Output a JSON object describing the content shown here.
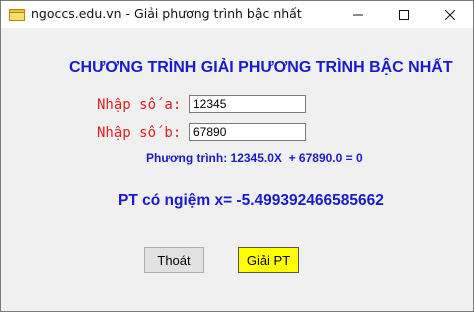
{
  "window": {
    "title": "ngoccs.edu.vn - Giải phương trình bậc nhất"
  },
  "heading": "CHƯƠNG TRÌNH GIẢI PHƯƠNG TRÌNH BẬC NHẤT",
  "form": {
    "label_a": "Nhập số a:",
    "value_a": "12345",
    "label_b": "Nhập số b:",
    "value_b": "67890"
  },
  "equation_text": "Phương trình: 12345.0X  + 67890.0 = 0",
  "result_text": "PT có ngiệm x= -5.499392466585662",
  "buttons": {
    "exit_label": "Thoát",
    "solve_label": "Giải PT"
  },
  "colors": {
    "heading": "#1a1acc",
    "labels": "#e02020",
    "solve_button": "#ffff00"
  },
  "icons": {
    "app": "app-window-icon",
    "minimize": "minimize-icon",
    "maximize": "maximize-icon",
    "close": "close-icon"
  }
}
